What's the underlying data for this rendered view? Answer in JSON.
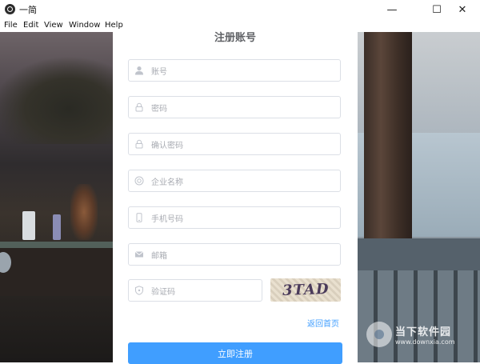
{
  "window": {
    "title": "一简",
    "minimize_glyph": "—",
    "maximize_glyph": "☐",
    "close_glyph": "✕"
  },
  "menu": {
    "items": [
      "File",
      "Edit",
      "View",
      "Window",
      "Help"
    ]
  },
  "form": {
    "title": "注册账号",
    "fields": [
      {
        "placeholder": "账号",
        "icon": "user-icon"
      },
      {
        "placeholder": "密码",
        "icon": "lock-icon"
      },
      {
        "placeholder": "确认密码",
        "icon": "lock-icon"
      },
      {
        "placeholder": "企业名称",
        "icon": "building-icon"
      },
      {
        "placeholder": "手机号码",
        "icon": "phone-icon"
      },
      {
        "placeholder": "邮箱",
        "icon": "mail-icon"
      },
      {
        "placeholder": "验证码",
        "icon": "shield-icon"
      }
    ],
    "captcha_text": "3TAD",
    "back_link": "返回首页",
    "submit_label": "立即注册"
  },
  "watermark": {
    "cn": "当下软件园",
    "en": "www.downxia.com"
  },
  "colors": {
    "accent": "#409eff",
    "border": "#dcdfe6",
    "placeholder": "#a8abb2"
  }
}
